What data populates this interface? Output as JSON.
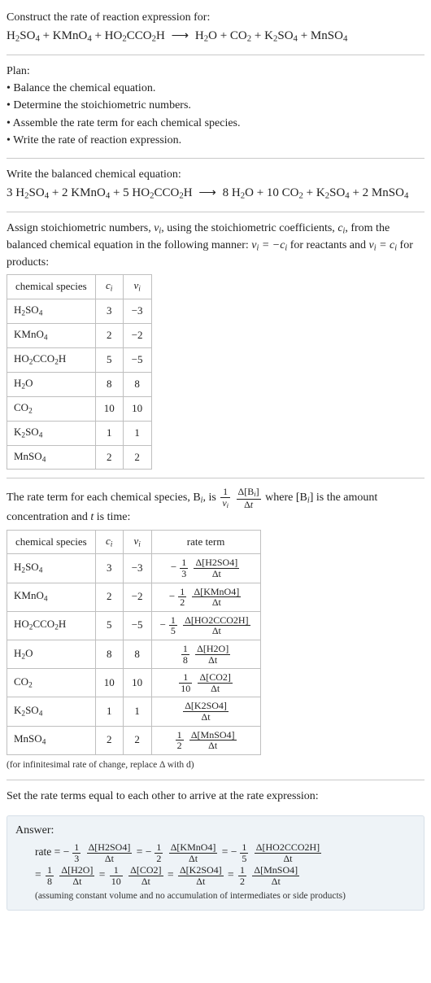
{
  "chart_data": [
    {
      "type": "table",
      "title": "stoichiometric numbers",
      "columns": [
        "chemical species",
        "c_i",
        "ν_i"
      ],
      "rows": [
        [
          "H2SO4",
          3,
          -3
        ],
        [
          "KMnO4",
          2,
          -2
        ],
        [
          "HO2CCO2H",
          5,
          -5
        ],
        [
          "H2O",
          8,
          8
        ],
        [
          "CO2",
          10,
          10
        ],
        [
          "K2SO4",
          1,
          1
        ],
        [
          "MnSO4",
          2,
          2
        ]
      ]
    },
    {
      "type": "table",
      "title": "rate terms",
      "columns": [
        "chemical species",
        "c_i",
        "ν_i",
        "rate term"
      ],
      "rows": [
        [
          "H2SO4",
          3,
          -3,
          "-(1/3) Δ[H2SO4]/Δt"
        ],
        [
          "KMnO4",
          2,
          -2,
          "-(1/2) Δ[KMnO4]/Δt"
        ],
        [
          "HO2CCO2H",
          5,
          -5,
          "-(1/5) Δ[HO2CCO2H]/Δt"
        ],
        [
          "H2O",
          8,
          8,
          "(1/8) Δ[H2O]/Δt"
        ],
        [
          "CO2",
          10,
          10,
          "(1/10) Δ[CO2]/Δt"
        ],
        [
          "K2SO4",
          1,
          1,
          "Δ[K2SO4]/Δt"
        ],
        [
          "MnSO4",
          2,
          2,
          "(1/2) Δ[MnSO4]/Δt"
        ]
      ]
    }
  ],
  "prompt": {
    "line1": "Construct the rate of reaction expression for:",
    "eq_lhs": "H₂SO₄ + KMnO₄ + HO₂CCO₂H",
    "eq_arrow": "⟶",
    "eq_rhs": "H₂O + CO₂ + K₂SO₄ + MnSO₄"
  },
  "plan": {
    "head": "Plan:",
    "items": [
      "• Balance the chemical equation.",
      "• Determine the stoichiometric numbers.",
      "• Assemble the rate term for each chemical species.",
      "• Write the rate of reaction expression."
    ]
  },
  "balanced": {
    "head": "Write the balanced chemical equation:",
    "eq_lhs": "3 H₂SO₄ + 2 KMnO₄ + 5 HO₂CCO₂H",
    "eq_arrow": "⟶",
    "eq_rhs": "8 H₂O + 10 CO₂ + K₂SO₄ + 2 MnSO₄"
  },
  "assign": {
    "para_a": "Assign stoichiometric numbers, ",
    "nu_i": "ν_i",
    "para_b": ", using the stoichiometric coefficients, ",
    "c_i": "c_i",
    "para_c": ", from the balanced chemical equation in the following manner: ",
    "rel_react": "ν_i = −c_i",
    "para_d": " for reactants and ",
    "rel_prod": "ν_i = c_i",
    "para_e": " for products:"
  },
  "table1": {
    "h1": "chemical species",
    "h2": "c_i",
    "h3": "ν_i",
    "r1": {
      "sp": "H₂SO₄",
      "c": "3",
      "n": "−3"
    },
    "r2": {
      "sp": "KMnO₄",
      "c": "2",
      "n": "−2"
    },
    "r3": {
      "sp": "HO₂CCO₂H",
      "c": "5",
      "n": "−5"
    },
    "r4": {
      "sp": "H₂O",
      "c": "8",
      "n": "8"
    },
    "r5": {
      "sp": "CO₂",
      "c": "10",
      "n": "10"
    },
    "r6": {
      "sp": "K₂SO₄",
      "c": "1",
      "n": "1"
    },
    "r7": {
      "sp": "MnSO₄",
      "c": "2",
      "n": "2"
    }
  },
  "rateterm": {
    "a": "The rate term for each chemical species, B",
    "b": ", is ",
    "frac1_num": "1",
    "frac1_den": "ν_i",
    "frac2_num": "Δ[B_i]",
    "frac2_den": "Δt",
    "c": " where [B",
    "d": "] is the amount concentration and ",
    "t": "t",
    "e": " is time:"
  },
  "table2": {
    "h1": "chemical species",
    "h2": "c_i",
    "h3": "ν_i",
    "h4": "rate term",
    "r1": {
      "sp": "H₂SO₄",
      "c": "3",
      "n": "−3",
      "f": {
        "sign": "−",
        "num": "1",
        "den": "3",
        "dnum": "Δ[H2SO4]",
        "dden": "Δt"
      }
    },
    "r2": {
      "sp": "KMnO₄",
      "c": "2",
      "n": "−2",
      "f": {
        "sign": "−",
        "num": "1",
        "den": "2",
        "dnum": "Δ[KMnO4]",
        "dden": "Δt"
      }
    },
    "r3": {
      "sp": "HO₂CCO₂H",
      "c": "5",
      "n": "−5",
      "f": {
        "sign": "−",
        "num": "1",
        "den": "5",
        "dnum": "Δ[HO2CCO2H]",
        "dden": "Δt"
      }
    },
    "r4": {
      "sp": "H₂O",
      "c": "8",
      "n": "8",
      "f": {
        "sign": "",
        "num": "1",
        "den": "8",
        "dnum": "Δ[H2O]",
        "dden": "Δt"
      }
    },
    "r5": {
      "sp": "CO₂",
      "c": "10",
      "n": "10",
      "f": {
        "sign": "",
        "num": "1",
        "den": "10",
        "dnum": "Δ[CO2]",
        "dden": "Δt"
      }
    },
    "r6": {
      "sp": "K₂SO₄",
      "c": "1",
      "n": "1",
      "f": {
        "sign": "",
        "num": "",
        "den": "",
        "dnum": "Δ[K2SO4]",
        "dden": "Δt"
      }
    },
    "r7": {
      "sp": "MnSO₄",
      "c": "2",
      "n": "2",
      "f": {
        "sign": "",
        "num": "1",
        "den": "2",
        "dnum": "Δ[MnSO4]",
        "dden": "Δt"
      }
    }
  },
  "note_inf": "(for infinitesimal rate of change, replace Δ with d)",
  "set_rate": "Set the rate terms equal to each other to arrive at the rate expression:",
  "answer": {
    "label": "Answer:",
    "lead": "rate = ",
    "cont": "= ",
    "t1": {
      "sign": "−",
      "num": "1",
      "den": "3",
      "dnum": "Δ[H2SO4]",
      "dden": "Δt"
    },
    "t2": {
      "sign": "−",
      "num": "1",
      "den": "2",
      "dnum": "Δ[KMnO4]",
      "dden": "Δt"
    },
    "t3": {
      "sign": "−",
      "num": "1",
      "den": "5",
      "dnum": "Δ[HO2CCO2H]",
      "dden": "Δt"
    },
    "t4": {
      "sign": "",
      "num": "1",
      "den": "8",
      "dnum": "Δ[H2O]",
      "dden": "Δt"
    },
    "t5": {
      "sign": "",
      "num": "1",
      "den": "10",
      "dnum": "Δ[CO2]",
      "dden": "Δt"
    },
    "t6": {
      "sign": "",
      "num": "",
      "den": "",
      "dnum": "Δ[K2SO4]",
      "dden": "Δt"
    },
    "t7": {
      "sign": "",
      "num": "1",
      "den": "2",
      "dnum": "Δ[MnSO4]",
      "dden": "Δt"
    },
    "eq": " = ",
    "assump": "(assuming constant volume and no accumulation of intermediates or side products)"
  }
}
